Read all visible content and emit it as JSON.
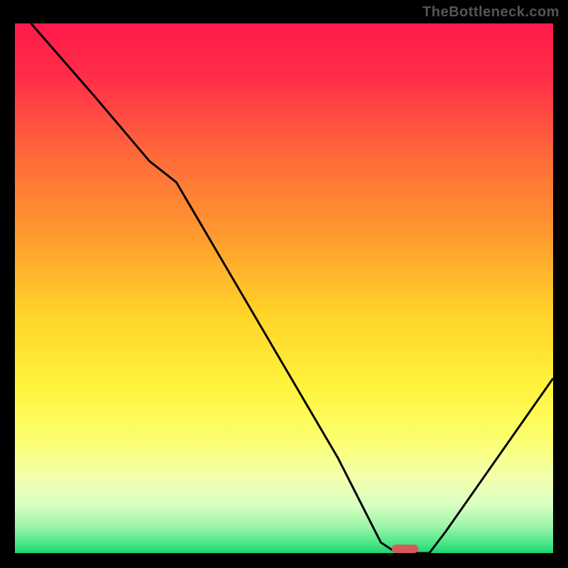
{
  "watermark": "TheBottleneck.com",
  "chart_data": {
    "type": "line",
    "title": "",
    "xlabel": "",
    "ylabel": "",
    "xlim": [
      0,
      100
    ],
    "ylim": [
      0,
      100
    ],
    "background_gradient": {
      "stops": [
        {
          "offset": 0.0,
          "color": "#ff1a4a"
        },
        {
          "offset": 0.1,
          "color": "#ff2d49"
        },
        {
          "offset": 0.25,
          "color": "#ff6a3a"
        },
        {
          "offset": 0.4,
          "color": "#ff9a2f"
        },
        {
          "offset": 0.55,
          "color": "#ffd428"
        },
        {
          "offset": 0.68,
          "color": "#fff23b"
        },
        {
          "offset": 0.78,
          "color": "#fcff6a"
        },
        {
          "offset": 0.86,
          "color": "#f2ffb0"
        },
        {
          "offset": 0.91,
          "color": "#d8ffc2"
        },
        {
          "offset": 0.95,
          "color": "#9cf5a8"
        },
        {
          "offset": 0.98,
          "color": "#4de88a"
        },
        {
          "offset": 1.0,
          "color": "#1fd372"
        }
      ]
    },
    "series": [
      {
        "name": "curve",
        "color": "#000000",
        "x": [
          3,
          15,
          25,
          30,
          60,
          68,
          71,
          74,
          77,
          80,
          100
        ],
        "y": [
          100,
          86,
          74,
          70,
          18,
          2,
          0,
          0,
          0,
          4,
          33
        ]
      }
    ],
    "marker": {
      "name": "target-marker",
      "color": "#d65a5a",
      "x_center": 72.5,
      "y": 0,
      "width": 5,
      "height": 1.6
    }
  }
}
